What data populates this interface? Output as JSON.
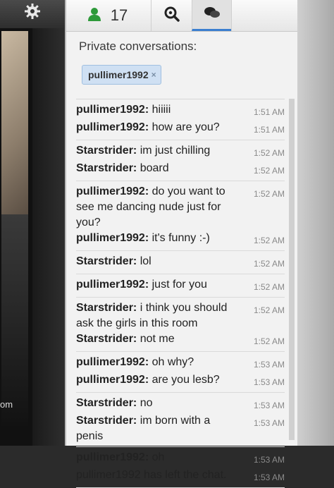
{
  "left_panel": {
    "settings_icon": "gear-icon",
    "partial_text": "om"
  },
  "tabs": {
    "users_icon": "user-icon",
    "user_count": "17",
    "search_icon": "search-icon",
    "chat_icon": "chat-bubbles-icon"
  },
  "private": {
    "title": "Private conversations:",
    "chip_label": "pullimer1992",
    "chip_close": "×"
  },
  "groups": [
    [
      {
        "sender": "pullimer1992:",
        "text": "hiiiii",
        "time": "1:51 AM"
      },
      {
        "sender": "pullimer1992:",
        "text": "how are you?",
        "time": "1:51 AM"
      }
    ],
    [
      {
        "sender": "Starstrider:",
        "text": "im just chilling",
        "time": "1:52 AM"
      },
      {
        "sender": "Starstrider:",
        "text": "board",
        "time": "1:52 AM"
      }
    ],
    [
      {
        "sender": "pullimer1992:",
        "text": "do you want to see me dancing nude just for you?",
        "time": "1:52 AM"
      },
      {
        "sender": "pullimer1992:",
        "text": "it's funny :-)",
        "time": "1:52 AM"
      }
    ],
    [
      {
        "sender": "Starstrider:",
        "text": "lol",
        "time": "1:52 AM"
      }
    ],
    [
      {
        "sender": "pullimer1992:",
        "text": "just for you",
        "time": "1:52 AM"
      }
    ],
    [
      {
        "sender": "Starstrider:",
        "text": "i think you should ask the girls in this room",
        "time": "1:52 AM"
      },
      {
        "sender": "Starstrider:",
        "text": "not me",
        "time": "1:52 AM"
      }
    ],
    [
      {
        "sender": "pullimer1992:",
        "text": "oh why?",
        "time": "1:53 AM"
      },
      {
        "sender": "pullimer1992:",
        "text": "are you lesb?",
        "time": "1:53 AM"
      }
    ],
    [
      {
        "sender": "Starstrider:",
        "text": "no",
        "time": "1:53 AM"
      },
      {
        "sender": "Starstrider:",
        "text": "im born with a penis",
        "time": "1:53 AM"
      }
    ],
    [
      {
        "sender": "pullimer1992:",
        "text": "oh",
        "time": "1:53 AM"
      },
      {
        "system": "pullimer1992 has left the chat.",
        "time": "1:53 AM"
      }
    ]
  ]
}
